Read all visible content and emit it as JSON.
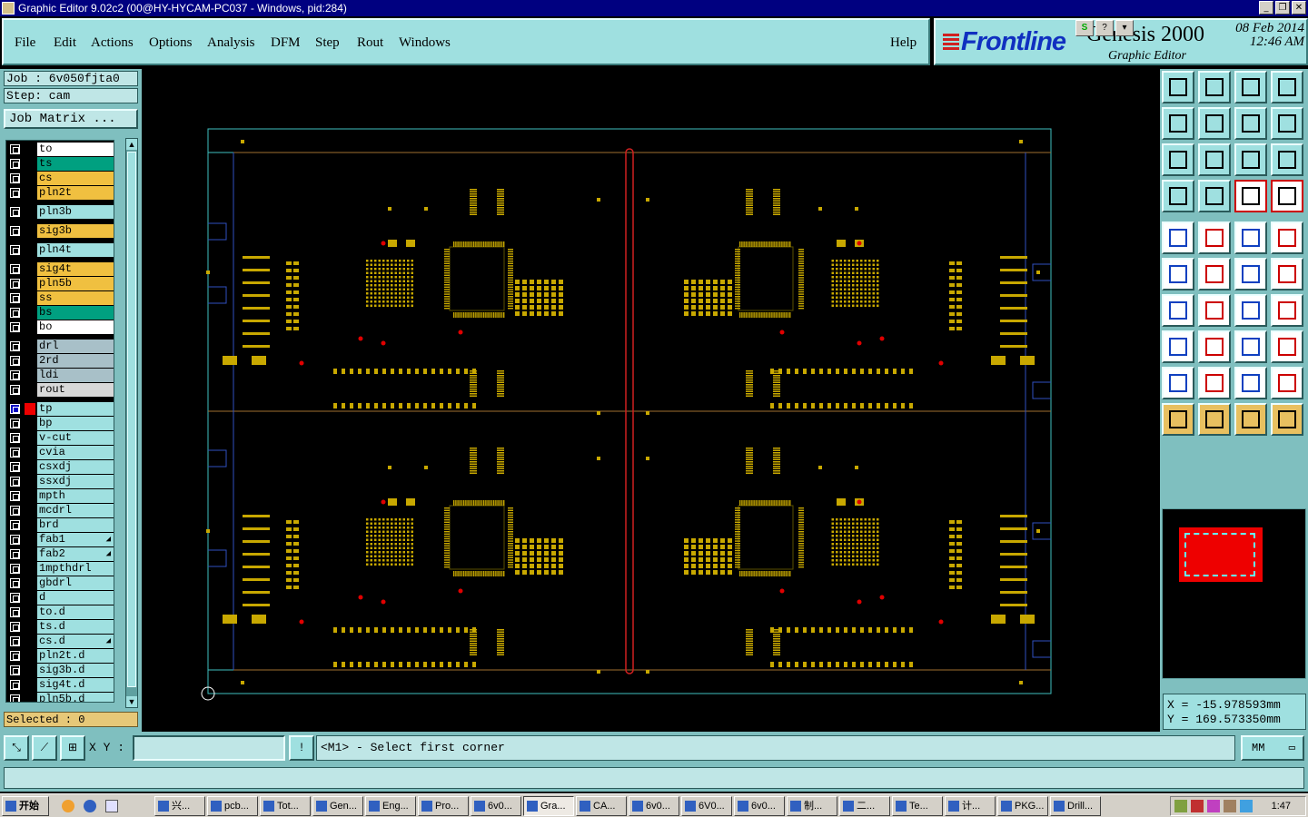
{
  "window": {
    "title": "Graphic Editor 9.02c2 (00@HY-HYCAM-PC037 - Windows, pid:284)"
  },
  "menu": [
    "File",
    "Edit",
    "Actions",
    "Options",
    "Analysis",
    "DFM",
    "Step",
    "Rout",
    "Windows"
  ],
  "help": "Help",
  "brand": {
    "logo": "Frontline",
    "product": "Genesis 2000",
    "subtitle": "Graphic Editor",
    "date": "08 Feb 2014",
    "time": "12:46 AM"
  },
  "job": {
    "job_label": "Job : 6v050fjta0",
    "step_label": "Step: cam",
    "matrix_button": "Job Matrix ..."
  },
  "layers": [
    {
      "name": "to",
      "color": "#ffffff"
    },
    {
      "name": "ts",
      "color": "#00a080"
    },
    {
      "name": "cs",
      "color": "#f0c040"
    },
    {
      "name": "pln2t",
      "color": "#f0c040"
    },
    {
      "name": "pln3b",
      "color": "#9fe0e0"
    },
    {
      "name": "sig3b",
      "color": "#f0c040"
    },
    {
      "name": "pln4t",
      "color": "#9fe0e0"
    },
    {
      "name": "sig4t",
      "color": "#f0c040"
    },
    {
      "name": "pln5b",
      "color": "#f0c040"
    },
    {
      "name": "ss",
      "color": "#f0c040"
    },
    {
      "name": "bs",
      "color": "#00a080"
    },
    {
      "name": "bo",
      "color": "#ffffff"
    },
    {
      "name": "drl",
      "color": "#a8c0c8"
    },
    {
      "name": "2rd",
      "color": "#a8c0c8"
    },
    {
      "name": "ldi",
      "color": "#a8c0c8"
    },
    {
      "name": "rout",
      "color": "#d8d8d8"
    },
    {
      "name": "tp",
      "color": "#9fe0e0"
    },
    {
      "name": "bp",
      "color": "#9fe0e0"
    },
    {
      "name": "v-cut",
      "color": "#9fe0e0"
    },
    {
      "name": "cvia",
      "color": "#9fe0e0"
    },
    {
      "name": "csxdj",
      "color": "#9fe0e0"
    },
    {
      "name": "ssxdj",
      "color": "#9fe0e0"
    },
    {
      "name": "mpth",
      "color": "#9fe0e0"
    },
    {
      "name": "mcdrl",
      "color": "#9fe0e0"
    },
    {
      "name": "brd",
      "color": "#9fe0e0"
    },
    {
      "name": "fab1",
      "color": "#9fe0e0"
    },
    {
      "name": "fab2",
      "color": "#9fe0e0"
    },
    {
      "name": "1mpthdrl",
      "color": "#9fe0e0"
    },
    {
      "name": "gbdrl",
      "color": "#9fe0e0"
    },
    {
      "name": "d",
      "color": "#9fe0e0"
    },
    {
      "name": "to.d",
      "color": "#9fe0e0"
    },
    {
      "name": "ts.d",
      "color": "#9fe0e0"
    },
    {
      "name": "cs.d",
      "color": "#9fe0e0"
    },
    {
      "name": "pln2t.d",
      "color": "#9fe0e0"
    },
    {
      "name": "sig3b.d",
      "color": "#9fe0e0"
    },
    {
      "name": "sig4t.d",
      "color": "#9fe0e0"
    },
    {
      "name": "pln5b.d",
      "color": "#9fe0e0"
    }
  ],
  "selected": "Selected : 0",
  "coords": {
    "x": "X = -15.978593mm",
    "y": "Y = 169.573350mm"
  },
  "xy_label": "X Y :",
  "xy_value": "",
  "prompt": "<M1> - Select first corner",
  "units": "MM",
  "taskbar": {
    "start": "开始",
    "tasks": [
      "兴...",
      "pcb...",
      "Tot...",
      "Gen...",
      "Eng...",
      "Pro...",
      "6v0...",
      "Gra...",
      "CA...",
      "6v0...",
      "6V0...",
      "6v0...",
      "制...",
      "二...",
      "Te...",
      "计...",
      "PKG...",
      "Drill..."
    ],
    "clock": "1:47"
  },
  "colors": {
    "panel": "#9fe0e0",
    "pad": "#c8a800",
    "outline": "#40c0c0",
    "via": "#e00000"
  }
}
